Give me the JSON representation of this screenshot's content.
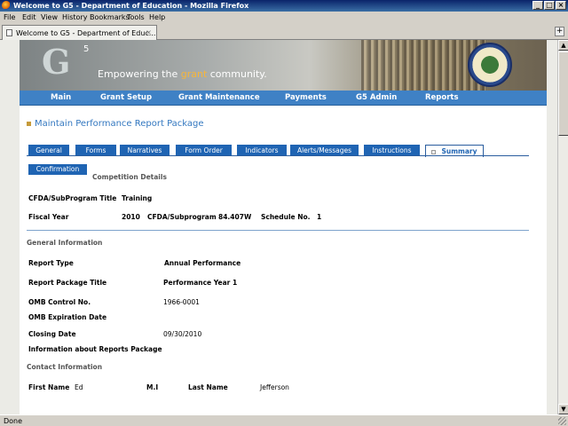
{
  "window": {
    "title": "Welcome to G5 - Department of Education - Mozilla Firefox"
  },
  "menu": [
    "File",
    "Edit",
    "View",
    "History",
    "Bookmarks",
    "Tools",
    "Help"
  ],
  "browser_tab": {
    "label": "Welcome to G5 - Department of Educ...",
    "close": "×",
    "new_tab": "+"
  },
  "banner": {
    "logo": "G",
    "logo_sup": "5",
    "tagline_pre": "Empowering the ",
    "tagline_hl": "grant",
    "tagline_post": " community."
  },
  "nav": [
    "Main",
    "Grant Setup",
    "Grant Maintenance",
    "Payments",
    "G5 Admin",
    "Reports"
  ],
  "page_title": "Maintain Performance Report Package",
  "tabs": [
    "General",
    "Forms",
    "Narratives",
    "Form Order",
    "Indicators",
    "Alerts/Messages",
    "Instructions",
    "Summary"
  ],
  "subtab": "Confirmation",
  "competition": {
    "header": "Competition Details",
    "cfda_title_label": "CFDA/SubProgram Title",
    "cfda_title_value": "Training",
    "fiscal_year_label": "Fiscal Year",
    "fiscal_year_value": "2010",
    "cfda_sub_label": "CFDA/Subprogram",
    "cfda_sub_value": "84.407W",
    "schedule_label": "Schedule No.",
    "schedule_value": "1"
  },
  "general": {
    "header": "General Information",
    "report_type_label": "Report Type",
    "report_type_value": "Annual Performance",
    "package_title_label": "Report Package Title",
    "package_title_value": "Performance Year 1",
    "omb_control_label": "OMB Control No.",
    "omb_control_value": "1966-0001",
    "omb_exp_label": "OMB Expiration Date",
    "closing_label": "Closing Date",
    "closing_value": "09/30/2010",
    "info_label": "Information about Reports Package"
  },
  "contact": {
    "header": "Contact Information",
    "first_label": "First Name",
    "first_value": "Ed",
    "mi_label": "M.I",
    "last_label": "Last Name",
    "last_value": "Jefferson"
  },
  "status": {
    "text": "Done"
  }
}
